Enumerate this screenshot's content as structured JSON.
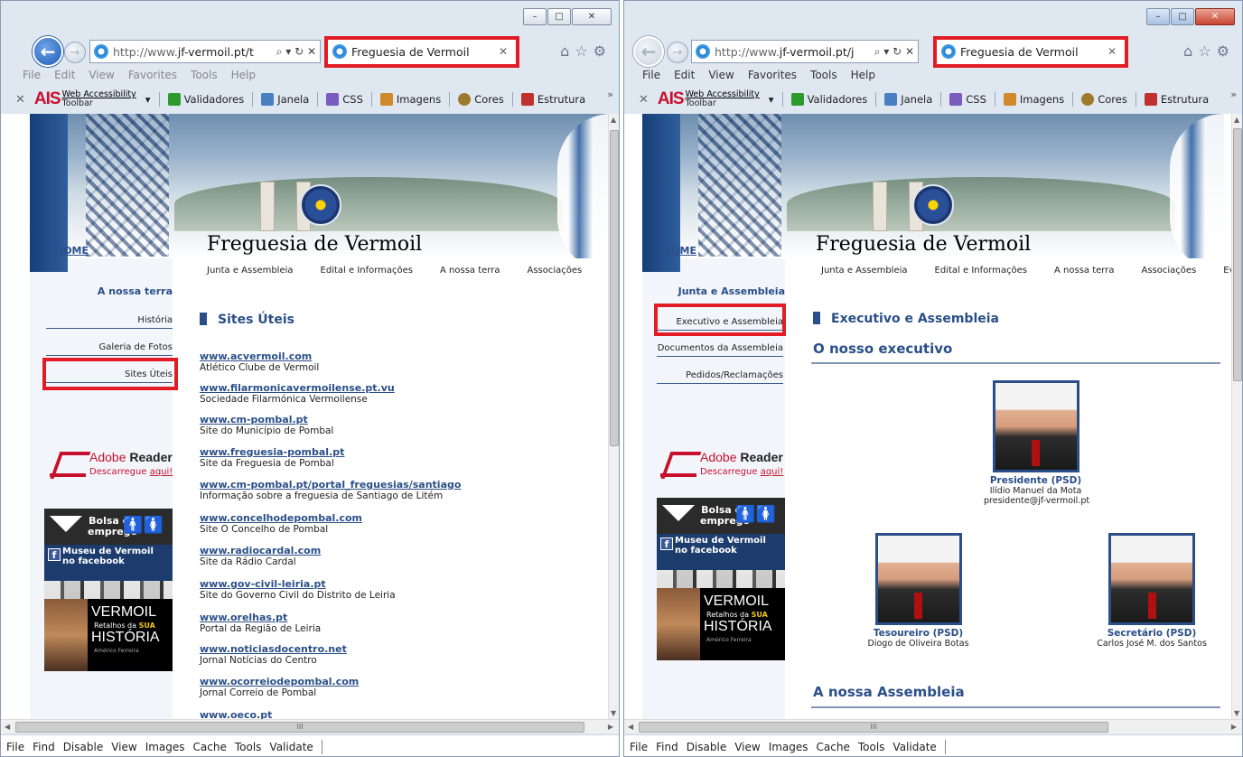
{
  "browser": {
    "url_prefix": "http://www.",
    "url_left_host": "jf-vermoil.pt/t",
    "url_right_host": "jf-vermoil.pt/j",
    "addr_controls": "⌕ ▾ ↻ ✕",
    "tab_title": "Freguesia de Vermoil",
    "tab_close": "✕",
    "toolbar_icons": "⌂☆⚙",
    "caption": {
      "min": "–",
      "max": "□",
      "close": "✕"
    }
  },
  "menubar": [
    "File",
    "Edit",
    "View",
    "Favorites",
    "Tools",
    "Help"
  ],
  "commandbar": {
    "close": "✕",
    "ais": "AIS",
    "wat_line1": "Web Accessibility",
    "wat_line2": "Toolbar",
    "dropdown": "▾",
    "items": [
      "Validadores",
      "Janela",
      "CSS",
      "Imagens",
      "Cores",
      "Estrutura"
    ],
    "more": "»",
    "icon_colors": [
      "#2e9a2e",
      "#4a7fc1",
      "#7a5cc0",
      "#d08a2a",
      "#9c7b2a",
      "#c03030"
    ]
  },
  "findbar": [
    "File",
    "Find",
    "Disable",
    "View",
    "Images",
    "Cache",
    "Tools",
    "Validate"
  ],
  "scroll_thumb_glyph": "III",
  "site": {
    "home": "HOME",
    "title": "Freguesia de Vermoil",
    "menu": [
      "Junta e Assembleia",
      "Edital e Informações",
      "A nossa terra",
      "Associações",
      "Event"
    ],
    "adobe_name": "Adobe",
    "adobe_reader": "Reader",
    "adobe_dl_prefix": "Descarregue ",
    "adobe_dl_link": "aqui!",
    "bolsa_line1": "Bolsa de",
    "bolsa_line2": "emprego",
    "bolsa_people": "🚹🚺",
    "fb_letter": "f",
    "museu_line1": "Museu de Vermoil",
    "museu_line2": "no facebook",
    "vermoil_big": "VERMOIL",
    "vermoil_small_a": "Retalhos da ",
    "vermoil_small_b": "SUA",
    "vermoil_hist": "HISTÓRIA",
    "vermoil_author": "Américo Ferreira"
  },
  "left": {
    "side_heading": "A nossa terra",
    "side_items": [
      "História",
      "Galeria de Fotos",
      "Sites Úteis"
    ],
    "heading": "Sites Úteis",
    "links": [
      {
        "url": "www.acvermoil.com",
        "desc": "Atlético Clube de Vermoil"
      },
      {
        "url": "www.filarmonicavermoilense.pt.vu",
        "desc": "Sociedade Filarmónica Vermoilense"
      },
      {
        "url": "www.cm-pombal.pt",
        "desc": "Site do Município de Pombal"
      },
      {
        "url": "www.freguesia-pombal.pt",
        "desc": "Site da Freguesia de Pombal"
      },
      {
        "url": "www.cm-pombal.pt/portal_freguesias/santiago",
        "desc": "Informação sobre a freguesia de Santiago de Litém"
      },
      {
        "url": "www.concelhodepombal.com",
        "desc": "Site O Concelho de Pombal"
      },
      {
        "url": "www.radiocardal.com",
        "desc": "Site da Rádio Cardal"
      },
      {
        "url": "www.gov-civil-leiria.pt",
        "desc": "Site do Governo Civil do Distrito de Leiria"
      },
      {
        "url": "www.orelhas.pt",
        "desc": "Portal da Região de Leiria"
      },
      {
        "url": "www.noticiasdocentro.net",
        "desc": "Jornal Notícias do Centro"
      },
      {
        "url": "www.ocorreiodepombal.com",
        "desc": "Jornal Correio de Pombal"
      },
      {
        "url": "www.oeco.pt",
        "desc": ""
      }
    ]
  },
  "right": {
    "side_heading": "Junta e Assembleia",
    "side_items": [
      "Executivo e Assembleia",
      "Documentos da Assembleia",
      "Pedidos/Reclamações"
    ],
    "heading": "Executivo e Assembleia",
    "sub1": "O nosso executivo",
    "sub2": "A nossa Assembleia",
    "people": [
      {
        "role": "Presidente (PSD)",
        "name": "Ilídio Manuel da Mota",
        "email": "presidente@jf-vermoil.pt"
      },
      {
        "role": "Tesoureiro (PSD)",
        "name": "Diogo de Oliveira Botas",
        "email": ""
      },
      {
        "role": "Secretário (PSD)",
        "name": "Carlos José M. dos Santos",
        "email": ""
      }
    ]
  },
  "colors": {
    "accent": "#2a4f88",
    "highlight": "#e21b24"
  }
}
